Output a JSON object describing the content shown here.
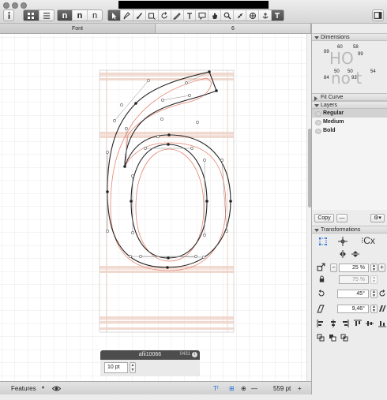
{
  "toolbar": {
    "info_icon": "info-icon",
    "view_modes": [
      "grid-view-icon",
      "list-view-icon"
    ],
    "glyph_modes": [
      "n",
      "n",
      "n"
    ],
    "tools": [
      "pointer-icon",
      "pen-icon",
      "brush-icon",
      "rectangle-icon",
      "rotate-icon",
      "knife-icon",
      "text-icon",
      "annotation-icon",
      "hand-icon",
      "zoom-icon",
      "measure-icon",
      "component-icon",
      "preview-icon"
    ]
  },
  "tabs": [
    {
      "label": "Font"
    },
    {
      "label": "6"
    }
  ],
  "glyph_panel": {
    "name": "afii10066",
    "code": "0431",
    "size_value": "10 pt"
  },
  "statusbar": {
    "features_label": "Features",
    "tf_label": "Tᶠ",
    "zoom_value": "559 pt",
    "zoom_out": "—",
    "zoom_in": "+"
  },
  "inspector": {
    "dimensions": {
      "title": "Dimensions",
      "top_values": [
        "89",
        "60",
        "58",
        "99"
      ],
      "bottom_values": [
        "84",
        "50",
        "50",
        "93",
        "54"
      ],
      "glyph_top": "HO",
      "glyph_bottom": "no t"
    },
    "fit_curve": {
      "title": "Fit Curve"
    },
    "layers": {
      "title": "Layers",
      "items": [
        "Regular",
        "Medium",
        "Bold"
      ],
      "selected": "Regular"
    },
    "copy_label": "Copy",
    "minus_label": "—",
    "transformations": {
      "title": "Transformations",
      "origin_label": "Cx",
      "scale_value": "25 %",
      "scale_value_2": "75 %",
      "rotate_value": "45°",
      "slant_value": "9,46°"
    }
  },
  "colors": {
    "outline": "#222222",
    "guide_outline": "#e8846f",
    "metric_band": "#e6c3b3",
    "grid": "#e2e2e2",
    "accent": "#2a6fd8"
  }
}
